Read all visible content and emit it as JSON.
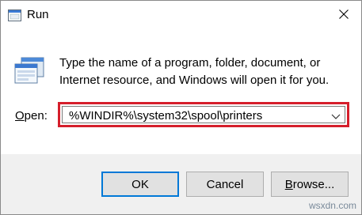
{
  "window": {
    "title": "Run",
    "close_symbol": "✕"
  },
  "prompt": {
    "line1": "Type the name of a program, folder, document, or",
    "line2": "Internet resource, and Windows will open it for you."
  },
  "open": {
    "label_first": "O",
    "label_rest": "pen:",
    "value": "%WINDIR%\\system32\\spool\\printers"
  },
  "buttons": {
    "ok": "OK",
    "cancel": "Cancel",
    "browse_first": "B",
    "browse_rest": "rowse..."
  },
  "watermark": "wsxdn.com",
  "colors": {
    "highlight_border": "#d51e2b",
    "default_button_border": "#0078d7",
    "footer_bg": "#f0f0f0"
  },
  "icons": [
    "run-app-icon",
    "close-icon",
    "run-program-icon",
    "chevron-down-icon"
  ]
}
